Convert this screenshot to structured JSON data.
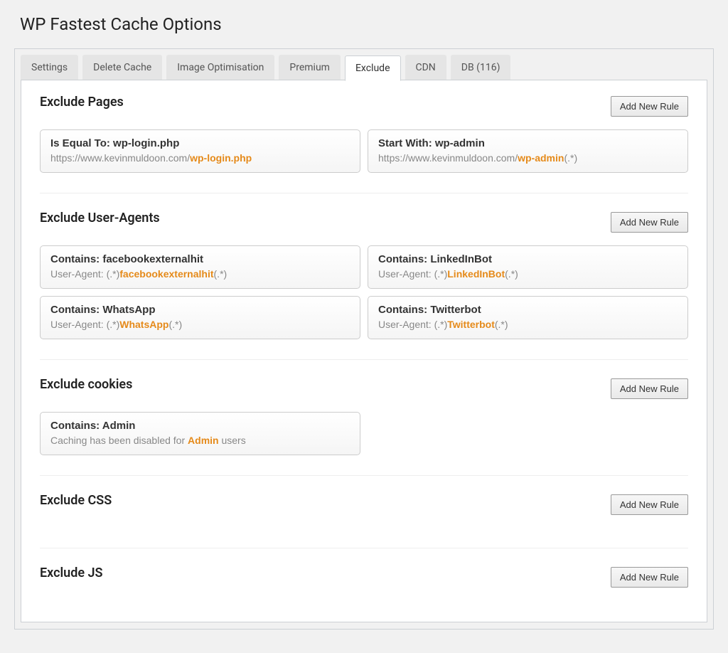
{
  "page_title": "WP Fastest Cache Options",
  "tabs": [
    {
      "label": "Settings",
      "active": false
    },
    {
      "label": "Delete Cache",
      "active": false
    },
    {
      "label": "Image Optimisation",
      "active": false
    },
    {
      "label": "Premium",
      "active": false
    },
    {
      "label": "Exclude",
      "active": true
    },
    {
      "label": "CDN",
      "active": false
    },
    {
      "label": "DB (116)",
      "active": false
    }
  ],
  "add_rule_label": "Add New Rule",
  "sections": [
    {
      "title": "Exclude Pages",
      "rules": [
        {
          "title": "Is Equal To: wp-login.php",
          "desc_pre": "https://www.kevinmuldoon.com/",
          "desc_hl": "wp-login.php",
          "desc_post": ""
        },
        {
          "title": "Start With: wp-admin",
          "desc_pre": "https://www.kevinmuldoon.com/",
          "desc_hl": "wp-admin",
          "desc_post": "(.*)"
        }
      ]
    },
    {
      "title": "Exclude User-Agents",
      "rules": [
        {
          "title": "Contains: facebookexternalhit",
          "desc_pre": "User-Agent: (.*)",
          "desc_hl": "facebookexternalhit",
          "desc_post": "(.*)"
        },
        {
          "title": "Contains: LinkedInBot",
          "desc_pre": "User-Agent: (.*)",
          "desc_hl": "LinkedInBot",
          "desc_post": "(.*)"
        },
        {
          "title": "Contains: WhatsApp",
          "desc_pre": "User-Agent: (.*)",
          "desc_hl": "WhatsApp",
          "desc_post": "(.*)"
        },
        {
          "title": "Contains: Twitterbot",
          "desc_pre": "User-Agent: (.*)",
          "desc_hl": "Twitterbot",
          "desc_post": "(.*)"
        }
      ]
    },
    {
      "title": "Exclude cookies",
      "rules": [
        {
          "title": "Contains: Admin",
          "desc_pre": "Caching has been disabled for ",
          "desc_hl": "Admin",
          "desc_post": " users"
        }
      ]
    },
    {
      "title": "Exclude CSS",
      "rules": []
    },
    {
      "title": "Exclude JS",
      "rules": []
    }
  ]
}
